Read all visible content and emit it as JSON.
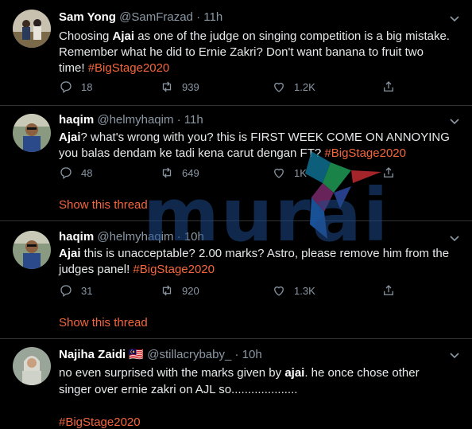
{
  "tweets": [
    {
      "name": "Sam Yong",
      "handle": "@SamFrazad",
      "time": "11h",
      "lines": [
        [
          {
            "t": "Choosing "
          },
          {
            "t": "Ajai",
            "b": true
          },
          {
            "t": " as one of the judge on singing competition is a big mistake."
          }
        ],
        [
          {
            "t": "Remember what he did to Ernie Zakri? Don't want banana to fruit two"
          }
        ],
        [
          {
            "t": "time! "
          },
          {
            "t": "#BigStage2020",
            "tag": true
          }
        ]
      ],
      "replies": "18",
      "retweets": "939",
      "likes": "1.2K"
    },
    {
      "name": "haqim",
      "handle": "@helmyhaqim",
      "time": "11h",
      "lines": [
        [
          {
            "t": "Ajai",
            "b": true
          },
          {
            "t": "? what's wrong with you? this is FIRST WEEK COME ON ANNOYING"
          }
        ],
        [
          {
            "t": "you balas dendam ke tadi kena carut dengan FT? "
          },
          {
            "t": "#BigStage2020",
            "tag": true
          }
        ]
      ],
      "replies": "48",
      "retweets": "649",
      "likes": "1K",
      "show_thread": "Show this thread"
    },
    {
      "name": "haqim",
      "handle": "@helmyhaqim",
      "time": "10h",
      "lines": [
        [
          {
            "t": "Ajai",
            "b": true
          },
          {
            "t": " this is unacceptable? 2.00 marks? Astro, please remove him from the"
          }
        ],
        [
          {
            "t": "judges panel! "
          },
          {
            "t": "#BigStage2020",
            "tag": true
          }
        ]
      ],
      "replies": "31",
      "retweets": "920",
      "likes": "1.3K",
      "show_thread": "Show this thread"
    },
    {
      "name": "Najiha Zaidi",
      "flag": "🇲🇾",
      "handle": "@stillacrybaby_",
      "time": "10h",
      "lines": [
        [
          {
            "t": "no even surprised with the marks given by "
          },
          {
            "t": "ajai",
            "b": true
          },
          {
            "t": ". he once chose other"
          }
        ],
        [
          {
            "t": "singer over ernie zakri on AJL so...................."
          }
        ],
        [
          {
            "t": ""
          }
        ],
        [
          {
            "t": "#BigStage2020",
            "tag": true
          }
        ]
      ]
    }
  ],
  "dot": "·",
  "watermark_text": "murai",
  "colors": {
    "accent": "#f4663d",
    "muted": "#8b98a5",
    "border": "#2f3336",
    "watermark": "#1d4a8a"
  }
}
